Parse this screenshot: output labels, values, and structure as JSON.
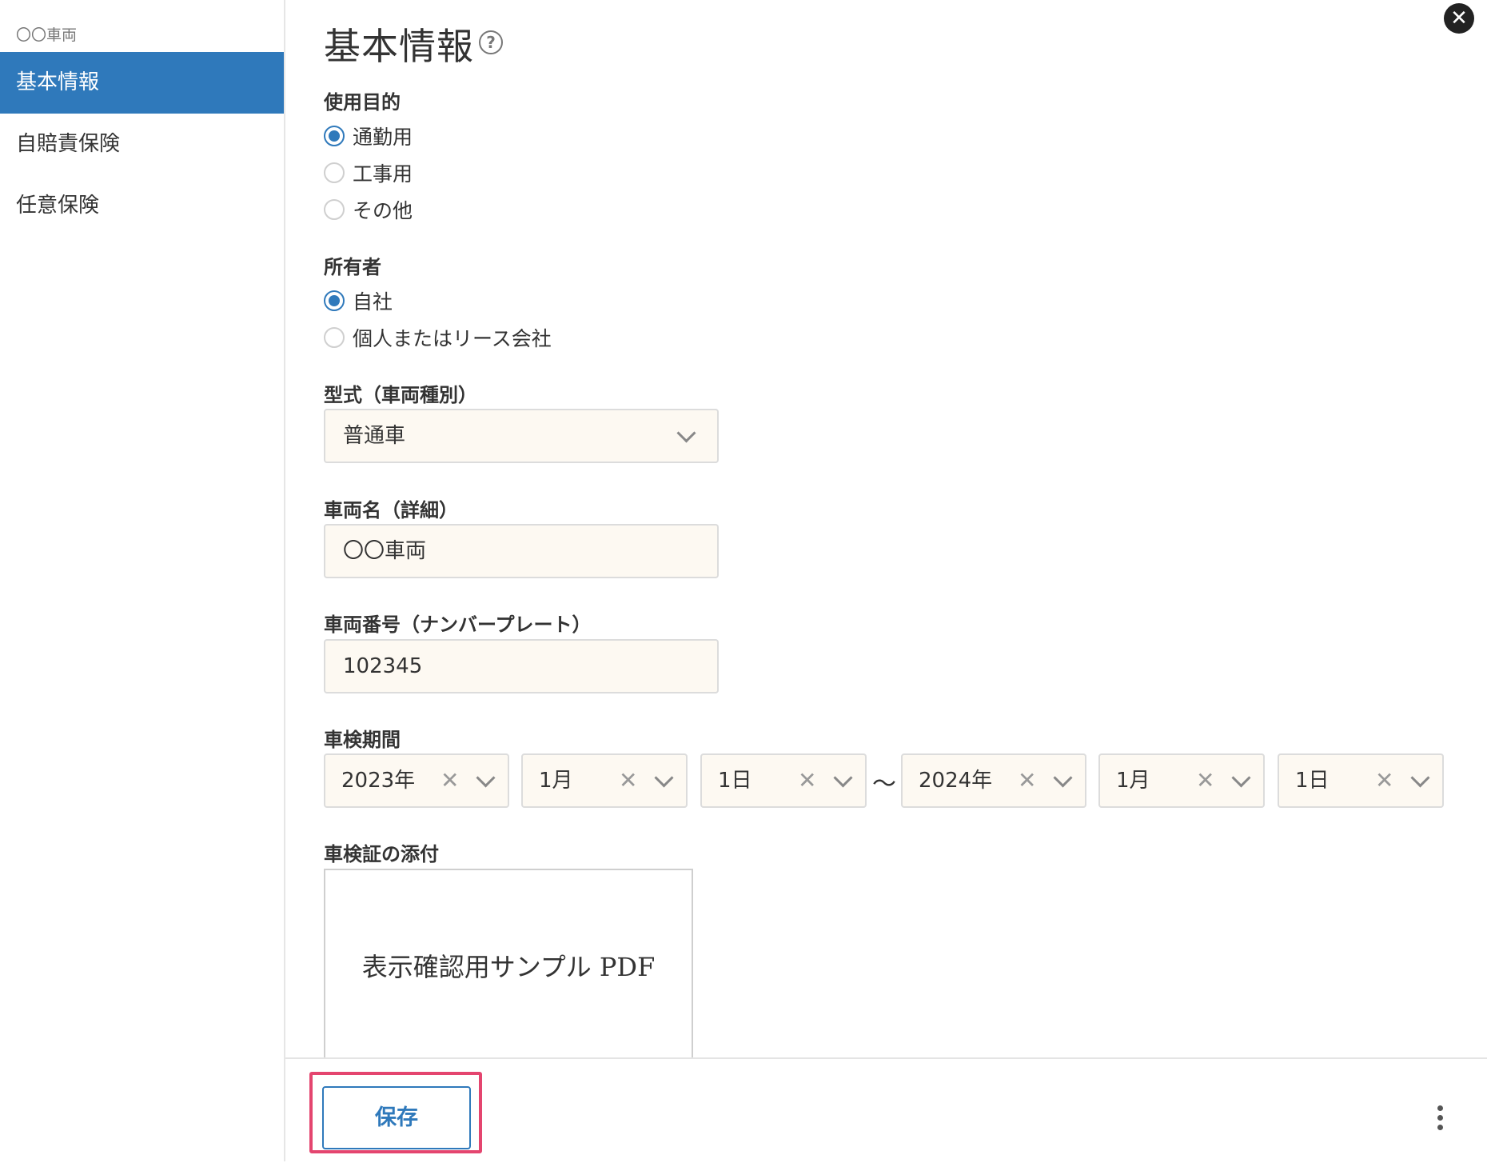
{
  "sidebar": {
    "header": "〇〇車両",
    "items": [
      {
        "label": "基本情報",
        "active": true
      },
      {
        "label": "自賠責保険",
        "active": false
      },
      {
        "label": "任意保険",
        "active": false
      }
    ]
  },
  "page": {
    "title": "基本情報",
    "help_icon": "?",
    "close_icon": "✕"
  },
  "usage": {
    "label": "使用目的",
    "options": [
      {
        "label": "通勤用",
        "checked": true
      },
      {
        "label": "工事用",
        "checked": false
      },
      {
        "label": "その他",
        "checked": false
      }
    ]
  },
  "owner": {
    "label": "所有者",
    "options": [
      {
        "label": "自社",
        "checked": true
      },
      {
        "label": "個人またはリース会社",
        "checked": false
      }
    ]
  },
  "model": {
    "label": "型式（車両種別）",
    "value": "普通車"
  },
  "vehicle_name": {
    "label": "車両名（詳細）",
    "value": "〇〇車両"
  },
  "vehicle_number": {
    "label": "車両番号（ナンバープレート）",
    "value": "102345"
  },
  "inspection_period": {
    "label": "車検期間",
    "start": {
      "year": "2023年",
      "month": "1月",
      "day": "1日"
    },
    "separator": "〜",
    "end": {
      "year": "2024年",
      "month": "1月",
      "day": "1日"
    },
    "clear_glyph": "✕"
  },
  "attachment": {
    "label": "車検証の添付",
    "preview_text": "表示確認用サンプル PDF"
  },
  "footer": {
    "save_label": "保存"
  },
  "colors": {
    "accent": "#2f79bb",
    "highlight": "#e4456f",
    "field_bg": "#fdf9f2"
  }
}
